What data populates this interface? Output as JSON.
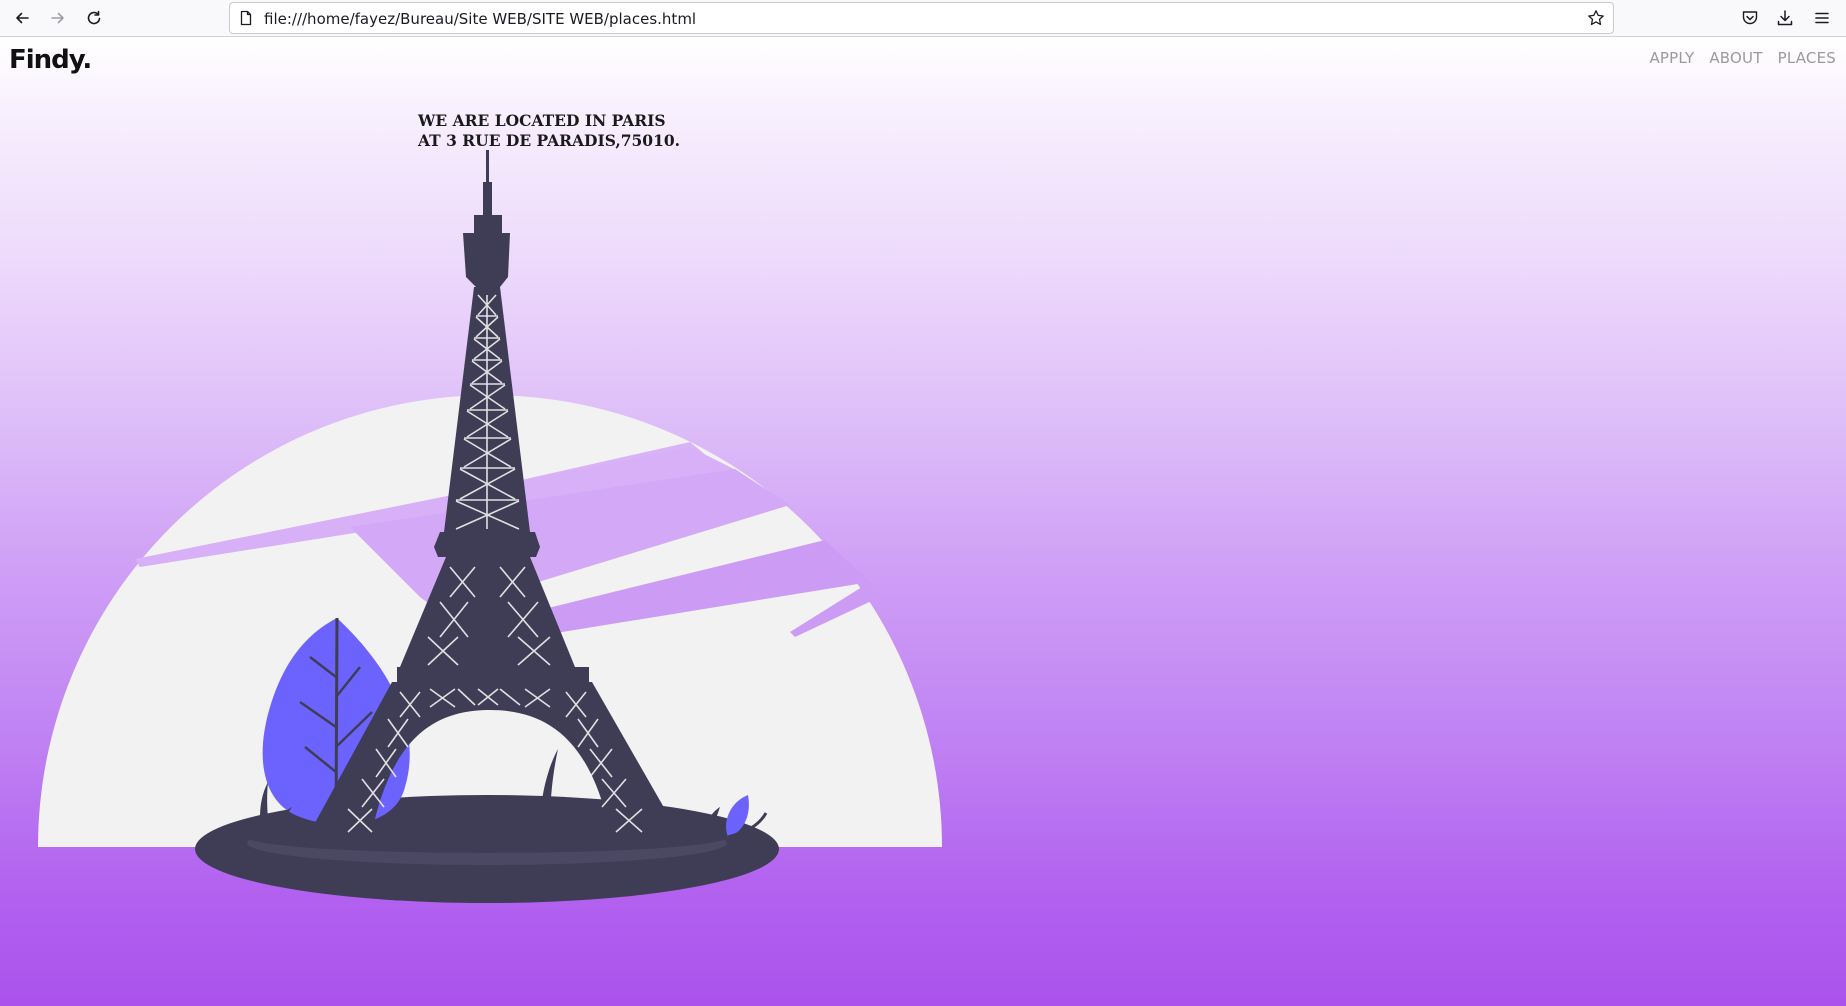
{
  "browser": {
    "url": "file:///home/fayez/Bureau/Site WEB/SITE WEB/places.html",
    "icons": [
      "back-icon",
      "forward-icon",
      "reload-icon",
      "page-icon",
      "bookmark-star-icon",
      "pocket-icon",
      "download-icon",
      "menu-icon"
    ]
  },
  "site": {
    "logo": "Findy.",
    "nav": [
      {
        "label": "APPLY"
      },
      {
        "label": "ABOUT"
      },
      {
        "label": "PLACES"
      }
    ],
    "location": {
      "line1": "WE ARE LOCATED IN PARIS",
      "line2": "AT 3 RUE DE PARADIS,75010."
    }
  },
  "colors": {
    "tower": "#3f3d56",
    "leaf": "#6c63ff",
    "sun_disc": "#f2f2f2",
    "gradient_top": "#ffffff",
    "gradient_bottom": "#ab52ee"
  }
}
